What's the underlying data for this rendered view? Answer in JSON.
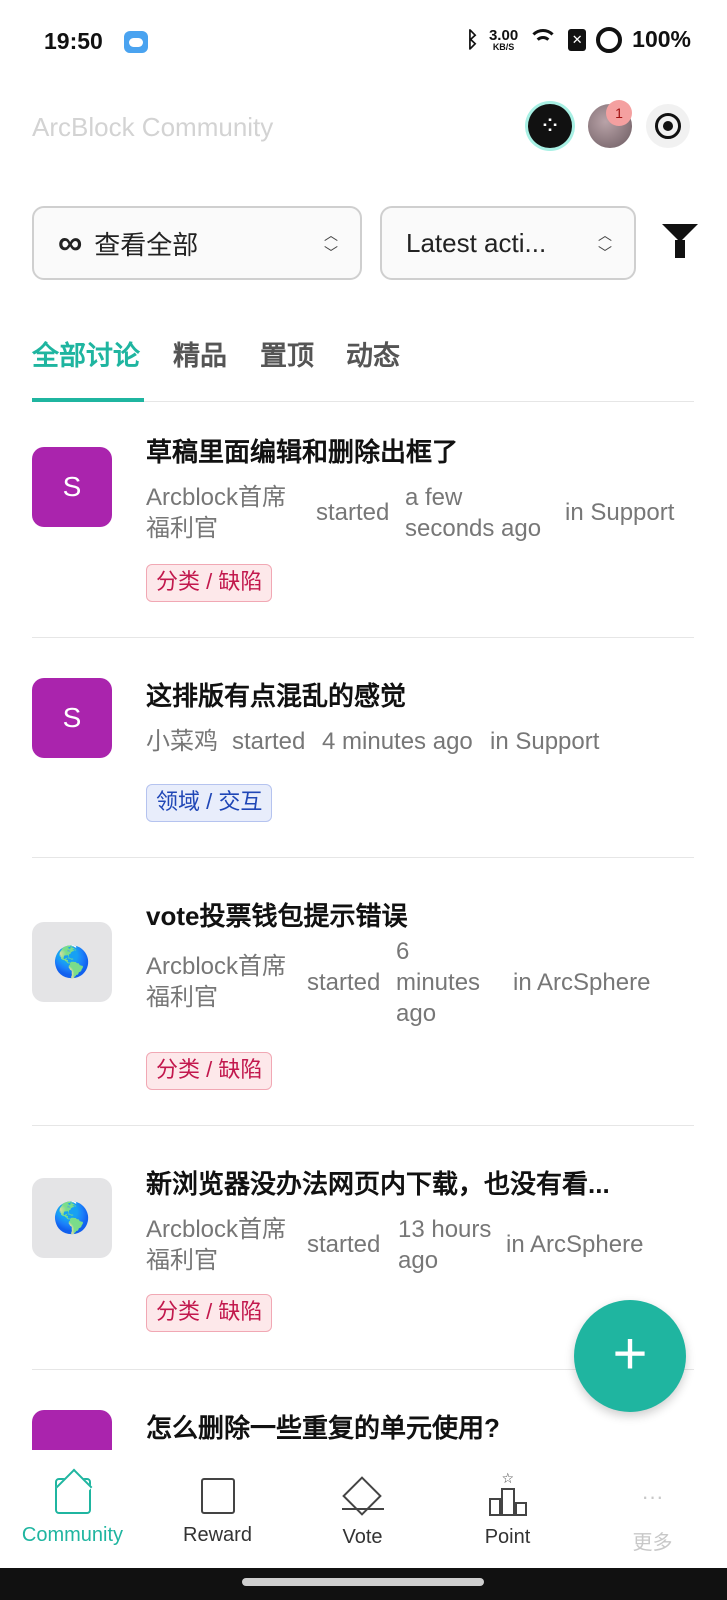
{
  "status_bar": {
    "time": "19:50",
    "net_speed": "3.00",
    "net_unit": "KB/S",
    "battery": "100%"
  },
  "header": {
    "title": "ArcBlock Community",
    "notification_count": "1"
  },
  "filters": {
    "scope_label": "查看全部",
    "sort_label": "Latest acti..."
  },
  "tabs": [
    "全部讨论",
    "精品",
    "置顶",
    "动态"
  ],
  "posts": [
    {
      "title": "草稿里面编辑和删除出框了",
      "avatar": "S",
      "author": "Arcblock首席福利官",
      "action": "started",
      "time": "a few seconds ago",
      "board": "in Support",
      "tag": "分类 / 缺陷"
    },
    {
      "title": "这排版有点混乱的感觉",
      "avatar": "S",
      "author": "小菜鸡",
      "action": "started",
      "time": "4 minutes ago",
      "board": "in Support",
      "tag": "领域 / 交互"
    },
    {
      "title": "vote投票钱包提示错误",
      "avatar": "🌎",
      "author": "Arcblock首席福利官",
      "action": "started",
      "time": "6 minutes ago",
      "board": "in ArcSphere",
      "tag": "分类 / 缺陷"
    },
    {
      "title": "新浏览器没办法网页内下载，也没有看...",
      "avatar": "🌎",
      "author": "Arcblock首席福利官",
      "action": "started",
      "time": "13 hours ago",
      "board": "in ArcSphere",
      "tag": "分类 / 缺陷"
    },
    {
      "title": "怎么删除一些重复的单元使用?"
    }
  ],
  "fab": {
    "label": "+"
  },
  "bottom_nav": [
    {
      "label": "Community"
    },
    {
      "label": "Reward"
    },
    {
      "label": "Vote"
    },
    {
      "label": "Point"
    },
    {
      "label": "更多"
    }
  ],
  "colors": {
    "accent": "#1fb5a0",
    "avatar_purple": "#aa24ad",
    "tag_red": "#c2184d",
    "tag_blue": "#1f46b6"
  }
}
